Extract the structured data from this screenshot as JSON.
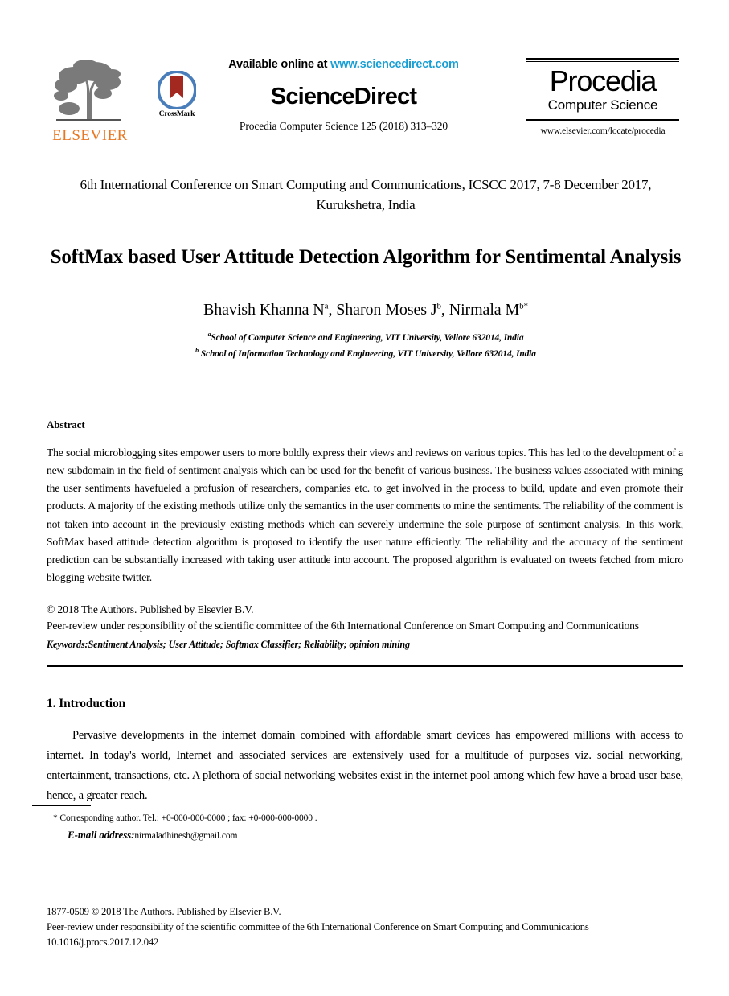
{
  "masthead": {
    "elsevier": {
      "wordmark": "ELSEVIER",
      "color": "#E87722",
      "icon": "elsevier-tree-logo"
    },
    "crossmark": {
      "label": "CrossMark",
      "icon": "crossmark-badge-icon",
      "ring_color": "#4A7EBB",
      "ribbon_color": "#A32820"
    },
    "sciencedirect": {
      "available_prefix": "Available online at ",
      "url": "www.sciencedirect.com",
      "url_color": "#189FD5",
      "wordmark": "ScienceDirect",
      "journal_line": "Procedia Computer Science 125 (2018) 313–320"
    },
    "procedia": {
      "name": "Procedia",
      "subtitle": "Computer Science",
      "url": "www.elsevier.com/locate/procedia"
    }
  },
  "conference": "6th International Conference on Smart Computing and Communications, ICSCC 2017, 7-8 December 2017, Kurukshetra, India",
  "title": "SoftMax based User Attitude Detection Algorithm for Sentimental Analysis",
  "authors": {
    "line": "Bhavish Khanna N",
    "author1_name": "Bhavish Khanna N",
    "author1_sup": "a",
    "author2_name": ", Sharon Moses J",
    "author2_sup": "b",
    "author3_name": ", Nirmala M",
    "author3_sup": "b*"
  },
  "affiliations": [
    {
      "sup": "a",
      "text": "School of Computer Science and Engineering, VIT University, Vellore 632014, India"
    },
    {
      "sup": "b",
      "text": " School of Information Technology and Engineering, VIT University, Vellore 632014, India"
    }
  ],
  "abstract": {
    "heading": "Abstract",
    "body": "The social microblogging sites empower users to more boldly express their views and reviews on various topics. This has led to the development of a new subdomain in the field of sentiment analysis which can be used for the benefit of various business. The business values associated with mining the user sentiments havefueled a profusion of researchers, companies etc. to get involved in the process to build, update and even promote their products. A majority of the existing methods utilize only the semantics in the user comments to mine the sentiments. The reliability of the comment is not taken into account in the previously existing methods which can severely undermine the sole purpose of sentiment analysis. In this work, SoftMax based attitude detection algorithm is proposed to identify the user nature efficiently. The reliability and the accuracy of the sentiment prediction can be substantially increased with taking user attitude into account. The proposed algorithm is evaluated on tweets fetched from micro blogging website twitter."
  },
  "copyright": {
    "line1": "© 2018 The Authors. Published by Elsevier B.V.",
    "line2": "Peer-review under responsibility of the scientific committee of the 6th International Conference on Smart Computing and Communications"
  },
  "keywords": "Keywords:Sentiment Analysis; User Attitude; Softmax Classifier; Reliability; opinion mining",
  "introduction": {
    "heading": "1. Introduction",
    "body": "Pervasive developments in the internet domain combined with affordable smart devices has empowered millions with access to internet. In today's world, Internet and associated services are extensively used for a multitude of purposes viz. social networking, entertainment, transactions, etc. A plethora of social networking websites exist in the internet pool among which few have a broad user base, hence, a greater reach."
  },
  "footnote": {
    "corresponding": "* Corresponding author. Tel.: +0-000-000-0000 ; fax: +0-000-000-0000 .",
    "email_label": "E-mail address:",
    "email": "nirmaladhinesh@gmail.com"
  },
  "page_footer": {
    "line1": "1877-0509 © 2018 The Authors. Published by Elsevier B.V.",
    "line2": "Peer-review under responsibility of the scientific committee of the 6th International Conference on Smart Computing and Communications",
    "line3": "10.1016/j.procs.2017.12.042"
  }
}
